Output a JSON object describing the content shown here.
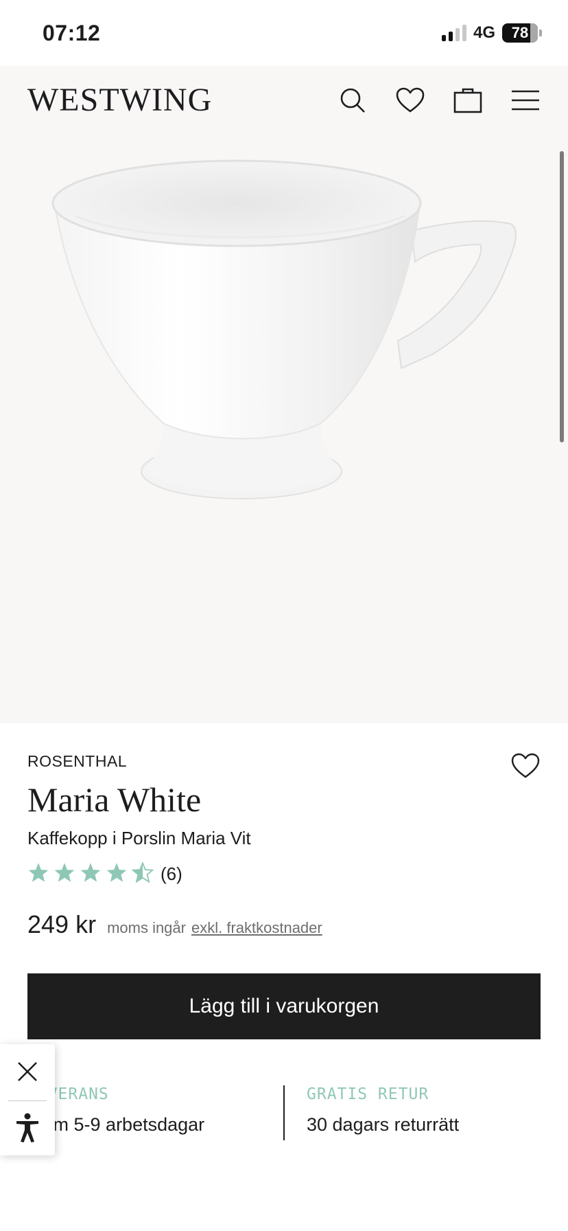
{
  "status_bar": {
    "time": "07:12",
    "network": "4G",
    "battery": "78"
  },
  "header": {
    "logo": "WESTWING"
  },
  "product": {
    "brand": "ROSENTHAL",
    "title": "Maria White",
    "subtitle": "Kaffekopp i Porslin Maria Vit",
    "rating": 4.5,
    "review_count": "(6)",
    "price": "249 kr",
    "vat_note": "moms ingår",
    "shipping_link": "exkl. fraktkostnader"
  },
  "cart_button": {
    "label": "Lägg till i varukorgen"
  },
  "usps": [
    {
      "label": "LEVERANS",
      "value": "Inom 5-9 arbetsdagar"
    },
    {
      "label": "GRATIS RETUR",
      "value": "30 dagars returrätt"
    }
  ],
  "colors": {
    "accent": "#8fc7b6",
    "button": "#1e1e1f",
    "image_bg": "#f8f7f6"
  },
  "icons": [
    "search-icon",
    "heart-icon",
    "bag-icon",
    "menu-icon",
    "star-icon",
    "close-icon",
    "accessibility-icon"
  ]
}
